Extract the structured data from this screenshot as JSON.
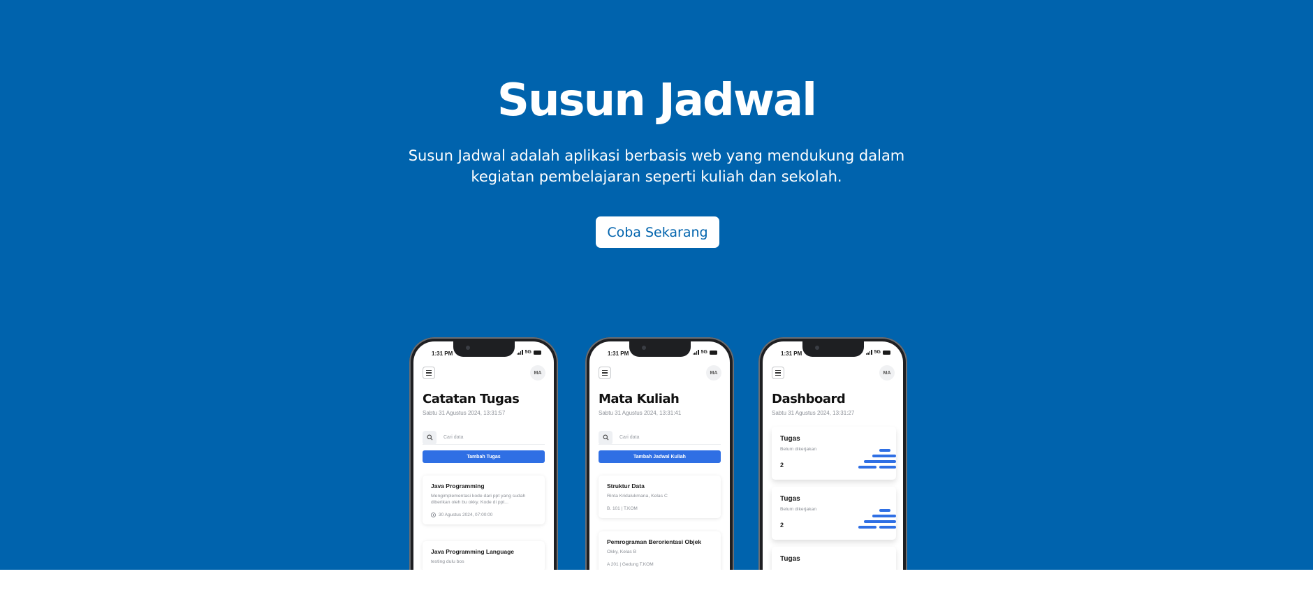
{
  "hero": {
    "title": "Susun Jadwal",
    "description": "Susun Jadwal adalah aplikasi berbasis web yang mendukung dalam kegiatan pembelajaran seperti kuliah dan sekolah.",
    "cta_label": "Coba Sekarang",
    "background_color": "#0063ad"
  },
  "phones": [
    {
      "status_time": "1:31 PM",
      "network": "5G",
      "avatar": "MA",
      "title": "Catatan Tugas",
      "date": "Sabtu 31 Agustus 2024, 13:31:57",
      "search_placeholder": "Cari data",
      "add_button": "Tambah Tugas",
      "cards": [
        {
          "title": "Java Programming",
          "text": "Mengimplementasi kode dari ppt yang sudah diberikan oleh bu okky. Kode di ppt...",
          "meta": "30 Agustus 2024, 07:00:00"
        },
        {
          "title": "Java Programming Language",
          "text": "testing dulu bos"
        }
      ]
    },
    {
      "status_time": "1:31 PM",
      "network": "5G",
      "avatar": "MA",
      "title": "Mata Kuliah",
      "date": "Sabtu 31 Agustus 2024, 13:31:41",
      "search_placeholder": "Cari data",
      "add_button": "Tambah Jadwal Kuliah",
      "cards": [
        {
          "title": "Struktur Data",
          "text": "Rinta Kridalukmana, Kelas C",
          "meta": "B. 101 | T.KOM"
        },
        {
          "title": "Pemrograman Berorientasi Objek",
          "text": "Okky, Kelas B",
          "meta": "A 201 | Gedung T.KOM"
        }
      ]
    },
    {
      "status_time": "1:31 PM",
      "network": "5G",
      "avatar": "MA",
      "title": "Dashboard",
      "date": "Sabtu 31 Agustus 2024, 13:31:27",
      "cards": [
        {
          "title": "Tugas",
          "text": "Belum dikerjakan",
          "count": "2"
        },
        {
          "title": "Tugas",
          "text": "Belum dikerjakan",
          "count": "2"
        },
        {
          "title": "Tugas"
        }
      ]
    }
  ]
}
